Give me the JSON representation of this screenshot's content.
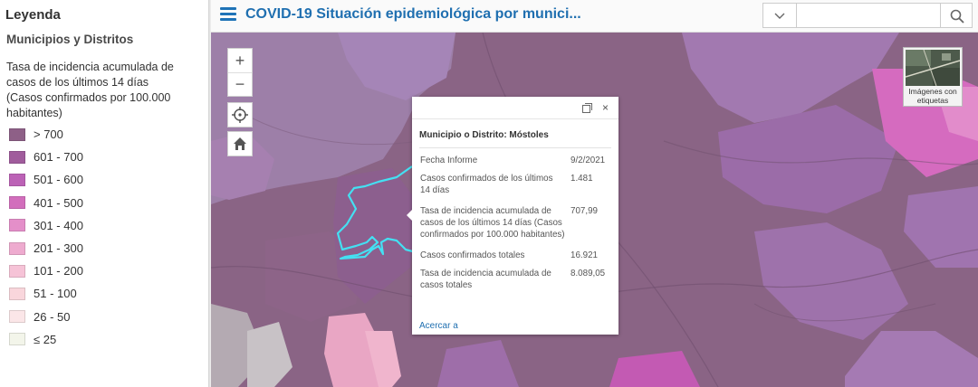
{
  "legend": {
    "title": "Leyenda",
    "layer_title": "Municipios y Distritos",
    "description": "Tasa de incidencia acumulada de casos de los últimos 14 días (Casos confirmados por 100.000 habitantes)",
    "items": [
      {
        "label": "> 700",
        "color": "#8e6087"
      },
      {
        "label": "601 - 700",
        "color": "#a05c9c"
      },
      {
        "label": "501 - 600",
        "color": "#bc62b6"
      },
      {
        "label": "401 - 500",
        "color": "#d26ebc"
      },
      {
        "label": "301 - 400",
        "color": "#e48fc9"
      },
      {
        "label": "201 - 300",
        "color": "#eeabcf"
      },
      {
        "label": "101 - 200",
        "color": "#f6c3d7"
      },
      {
        "label": "51 - 100",
        "color": "#f9d6dc"
      },
      {
        "label": "26 - 50",
        "color": "#fbe6e8"
      },
      {
        "label": "≤ 25",
        "color": "#f3f5ea"
      }
    ]
  },
  "header": {
    "menu_icon": "hamburger-menu-icon",
    "title": "COVID-19 Situación epidemiológica por munici...",
    "search": {
      "placeholder": "",
      "dropdown_icon": "chevron-down-icon",
      "button_icon": "search-icon"
    },
    "accent_color": "#1f6fb0"
  },
  "map": {
    "zoom_in_label": "+",
    "zoom_out_label": "−",
    "locate_icon": "crosshair-icon",
    "home_icon": "home-icon",
    "basemap_label": "Imágenes con etiquetas",
    "highlight_color": "#44e0f2"
  },
  "popup": {
    "title": "Municipio o Distrito: Móstoles",
    "maximize_icon": "maximize-icon",
    "close_label": "×",
    "rows": [
      {
        "key": "Fecha Informe",
        "value": "9/2/2021"
      },
      {
        "key": "Casos confirmados de los últimos 14 días",
        "value": "1.481"
      },
      {
        "key": "Tasa de incidencia acumulada de casos de los últimos 14 días (Casos confirmados por 100.000 habitantes)",
        "value": "707,99"
      },
      {
        "key": "Casos confirmados totales",
        "value": "16.921"
      },
      {
        "key": "Tasa de incidencia acumulada de casos totales",
        "value": "8.089,05"
      }
    ],
    "zoom_link": "Acercar a"
  }
}
